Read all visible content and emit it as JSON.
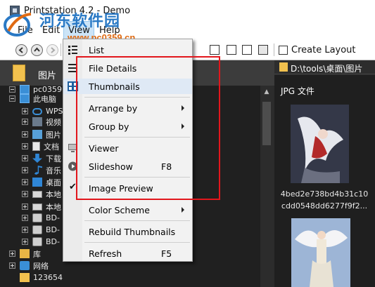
{
  "window": {
    "title": "Printstation 4.2 - Demo"
  },
  "watermark": {
    "main_text": "河东软件园",
    "url_text": "www.pc0359.cn"
  },
  "menubar": {
    "items": [
      "File",
      "Edit",
      "View",
      "Help"
    ]
  },
  "toolbar": {
    "create_layout_label": "Create Layout"
  },
  "tree_header": {
    "label": "图片"
  },
  "tree": {
    "items": [
      {
        "label": "pc0359"
      },
      {
        "label": "此电脑"
      },
      {
        "label": "WPS"
      },
      {
        "label": "视频"
      },
      {
        "label": "图片"
      },
      {
        "label": "文档"
      },
      {
        "label": "下载"
      },
      {
        "label": "音乐"
      },
      {
        "label": "桌面"
      },
      {
        "label": "本地"
      },
      {
        "label": "本地"
      },
      {
        "label": "BD-"
      },
      {
        "label": "BD-"
      },
      {
        "label": "BD-"
      },
      {
        "label": "库"
      },
      {
        "label": "网络"
      },
      {
        "label": "123654"
      }
    ]
  },
  "right_pane": {
    "path": "D:\\tools\\桌面\\图片",
    "group_header": "JPG 文件",
    "thumb1_caption_line1": "4bed2e738bd4b31c10",
    "thumb1_caption_line2": "cdd0548dd6277f9f2..."
  },
  "view_menu": {
    "items": [
      {
        "label": "List"
      },
      {
        "label": "File Details"
      },
      {
        "label": "Thumbnails"
      },
      {
        "label": "Arrange by"
      },
      {
        "label": "Group by"
      },
      {
        "label": "Viewer"
      },
      {
        "label": "Slideshow",
        "shortcut": "F8"
      },
      {
        "label": "Image Preview",
        "checked": true
      },
      {
        "label": "Color Scheme"
      },
      {
        "label": "Rebuild Thumbnails"
      },
      {
        "label": "Refresh",
        "shortcut": "F5"
      }
    ]
  },
  "annotation": {
    "highlight_color": "#e2161c"
  }
}
